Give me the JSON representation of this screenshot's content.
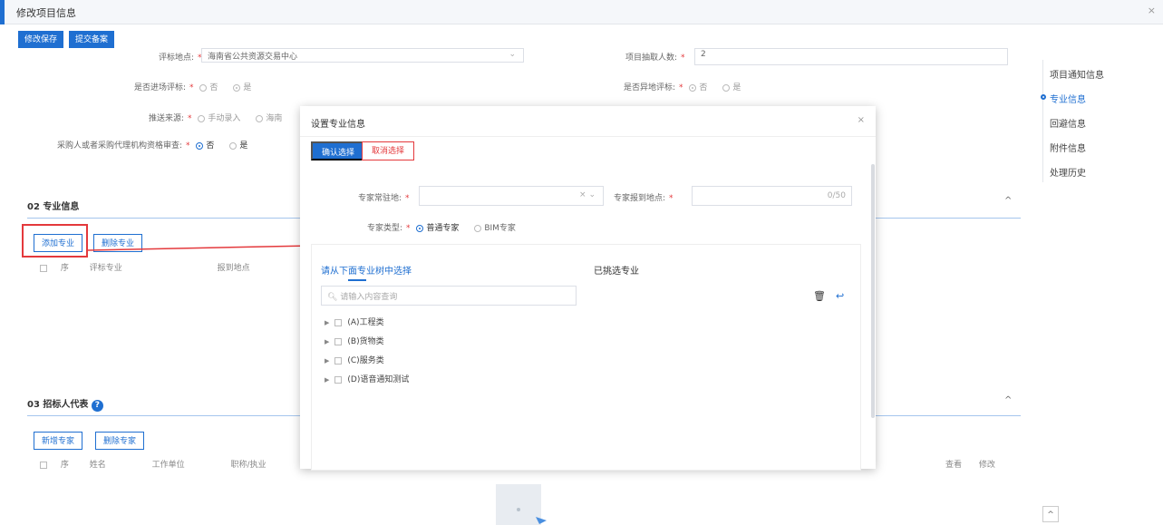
{
  "window": {
    "title": "修改项目信息",
    "close": "×"
  },
  "toolbar": {
    "save_label": "修改保存",
    "submit_label": "提交备案"
  },
  "form": {
    "eval_location_label": "评标地点:",
    "eval_location_value": "海南省公共资源交易中心",
    "extract_count_label": "项目抽取人数:",
    "extract_count_value": "2",
    "on_site_label": "是否进场评标:",
    "on_site_opt1": "否",
    "on_site_opt2": "是",
    "remote_label": "是否异地评标:",
    "remote_opt1": "否",
    "remote_opt2": "是",
    "push_source_label": "推送来源:",
    "push_opt1": "手动录入",
    "push_opt2": "海南",
    "qualify_label": "采购人或者采购代理机构资格审查:",
    "qualify_opt1": "否",
    "qualify_opt2": "是"
  },
  "section2": {
    "title": "02  专业信息",
    "add_label": "添加专业",
    "del_label": "删除专业",
    "cols": [
      "序",
      "评标专业",
      "报到地点"
    ]
  },
  "section3": {
    "title": "03  招标人代表",
    "help": "?",
    "add_label": "新增专家",
    "del_label": "删除专家",
    "cols": [
      "序",
      "姓名",
      "工作单位",
      "职称/执业"
    ],
    "right_cols": [
      "查看",
      "修改"
    ]
  },
  "caret_up": "^",
  "right_nav": {
    "items": [
      "项目通知信息",
      "专业信息",
      "回避信息",
      "附件信息",
      "处理历史"
    ]
  },
  "modal": {
    "title": "设置专业信息",
    "close": "×",
    "confirm_label": "确认选择",
    "cancel_label": "取消选择",
    "residence_label": "专家常驻地:",
    "report_label": "专家报到地点:",
    "report_counter": "0/50",
    "type_label": "专家类型:",
    "type_opt1": "普通专家",
    "type_opt2": "BIM专家",
    "tab_left": "请从下面专业树中选择",
    "tab_right": "已挑选专业",
    "search_placeholder": "请输入内容查询",
    "tree": [
      "(A)工程类",
      "(B)货物类",
      "(C)服务类",
      "(D)语音通知测试"
    ]
  },
  "colors": {
    "primary": "#1f6fd1",
    "danger": "#e4393c"
  }
}
